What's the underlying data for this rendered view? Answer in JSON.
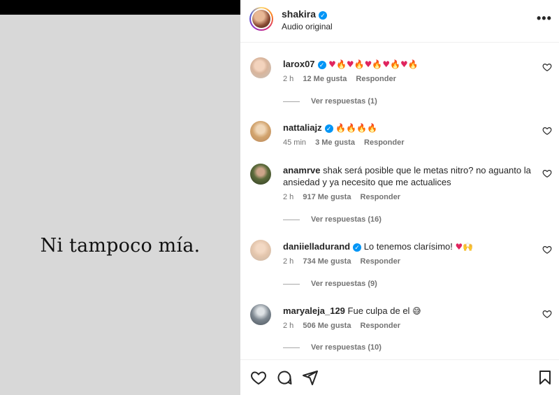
{
  "media": {
    "caption": "Ni tampoco mía."
  },
  "header": {
    "username": "shakira",
    "subtitle": "Audio original",
    "more_label": "•••"
  },
  "comments": [
    {
      "username": "larox07",
      "verified": true,
      "text": "",
      "emojis": [
        "heart",
        "fire",
        "heart",
        "fire",
        "heart",
        "fire",
        "heart",
        "fire",
        "heart",
        "fire"
      ],
      "time": "2 h",
      "likes": "12 Me gusta",
      "reply": "Responder",
      "replies": "Ver respuestas (1)"
    },
    {
      "username": "nattaliajz",
      "verified": true,
      "text": "",
      "emojis": [
        "fire",
        "fire",
        "fire",
        "fire"
      ],
      "time": "45 min",
      "likes": "3 Me gusta",
      "reply": "Responder",
      "replies": ""
    },
    {
      "username": "anamrve",
      "verified": false,
      "text": "shak será posible que le metas nitro? no aguanto la ansiedad y ya necesito que me actualices",
      "time": "2 h",
      "likes": "917 Me gusta",
      "reply": "Responder",
      "replies": "Ver respuestas (16)"
    },
    {
      "username": "daniielladurand",
      "verified": true,
      "text": "Lo tenemos clarísimo!",
      "time": "2 h",
      "likes": "734 Me gusta",
      "reply": "Responder",
      "replies": "Ver respuestas (9)"
    },
    {
      "username": "maryaleja_129",
      "verified": false,
      "text": "Fue culpa de el",
      "time": "2 h",
      "likes": "506 Me gusta",
      "reply": "Responder",
      "replies": "Ver respuestas (10)"
    }
  ],
  "actions": [
    "heart-icon",
    "comment-icon",
    "share-icon",
    "bookmark-icon"
  ]
}
